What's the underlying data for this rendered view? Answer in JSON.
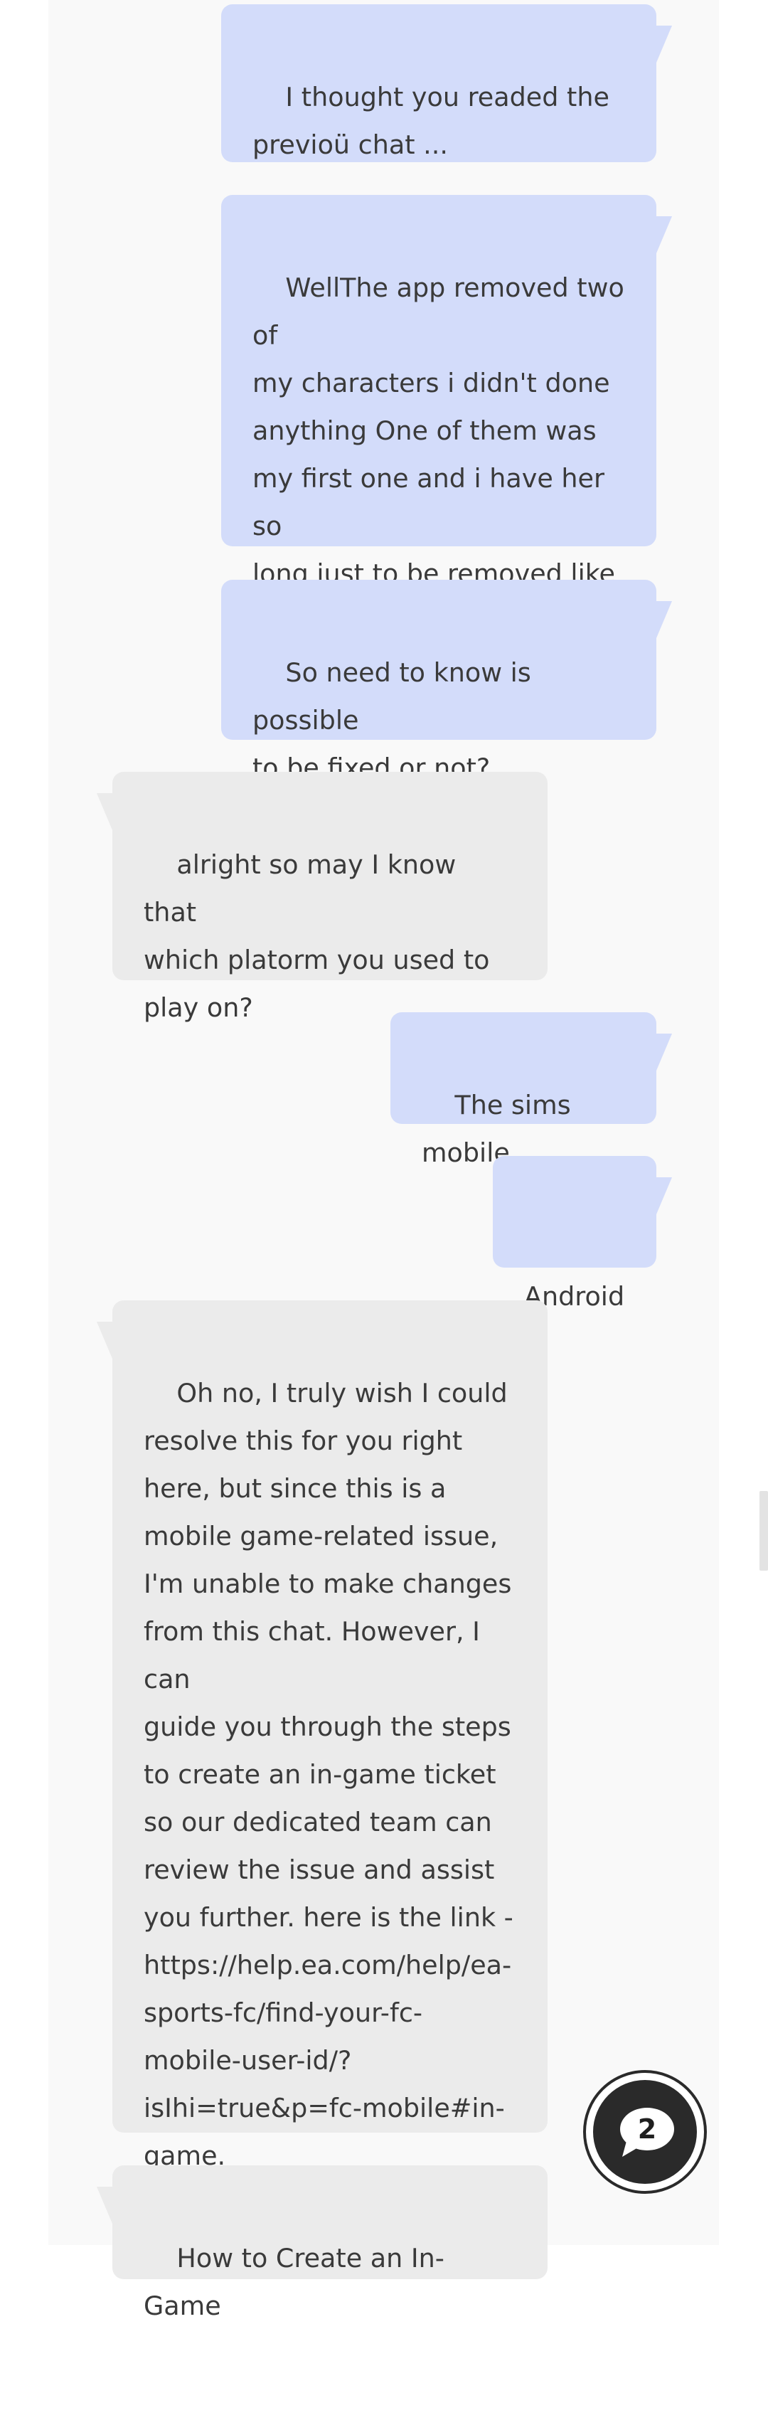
{
  "messages": [
    {
      "role": "user",
      "text": "I thought you readed the\nprevioü chat ..."
    },
    {
      "role": "user",
      "text": "WellThe app removed two of\nmy characters i didn't done\nanything One of them was\nmy first one and i have her so\nlong just to be removed like\nthat"
    },
    {
      "role": "user",
      "text": "So need to know is possible\nto be fixed or not?"
    },
    {
      "role": "agent",
      "text": "alright so may I know that\nwhich platorm you used to\nplay on?"
    },
    {
      "role": "user",
      "text": "The sims mobile"
    },
    {
      "role": "user",
      "text": "Android"
    },
    {
      "role": "agent",
      "text": "Oh no, I truly wish I could\nresolve this for you right\nhere, but since this is a\nmobile game-related issue,\nI'm unable to make changes\nfrom this chat. However, I can\nguide you through the steps\nto create an in-game ticket\nso our dedicated team can\nreview the issue and assist\nyou further. here is the link -\nhttps://help.ea.com/help/ea-\nsports-fc/find-your-fc-\nmobile-user-id/?\nisIhi=true&p=fc-mobile#in-\ngame."
    },
    {
      "role": "agent",
      "text": "How to Create an In-Game"
    }
  ],
  "chat_button": {
    "icon": "chat-bubble-icon",
    "unread_count": "2"
  },
  "colors": {
    "user_bubble": "#d3dcfa",
    "agent_bubble": "#ebebeb",
    "panel": "#f9f9f9",
    "text": "#3a3a3a",
    "fab": "#2a2a2a"
  }
}
